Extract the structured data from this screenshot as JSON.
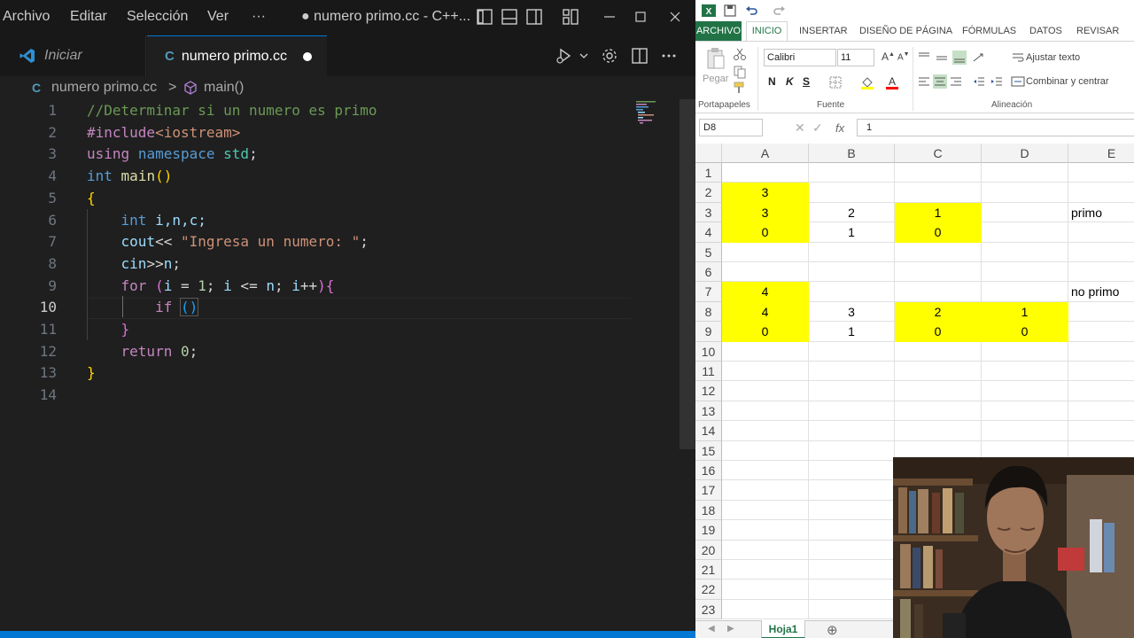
{
  "vscode": {
    "menu": [
      "Archivo",
      "Editar",
      "Selección",
      "Ver"
    ],
    "more": "···",
    "window_title": "● numero primo.cc - C++...",
    "tabs": {
      "start": "Iniciar",
      "file": "numero primo.cc",
      "file_badge": "C"
    },
    "breadcrumb": {
      "file": "numero primo.cc",
      "separator": ">",
      "symbol": "main()"
    },
    "line_numbers": [
      "1",
      "2",
      "3",
      "4",
      "5",
      "6",
      "7",
      "8",
      "9",
      "10",
      "11",
      "12",
      "13",
      "14"
    ],
    "active_line": "10",
    "code": {
      "l1": "//Determinar si un numero es primo",
      "l2_directive": "#include",
      "l2_header": "<iostream>",
      "l3_using": "using",
      "l3_namespace": "namespace",
      "l3_std": "std",
      "l3_semi": ";",
      "l4_int": "int",
      "l4_main": "main",
      "l4_parens": "()",
      "l5": "{",
      "l6_int": "int",
      "l6_vars": " i,n,c;",
      "l7_cout": "cout",
      "l7_op": "<< ",
      "l7_str": "\"Ingresa un numero: \"",
      "l7_semi": ";",
      "l8_cin": "cin",
      "l8_op": ">>",
      "l8_n": "n",
      "l8_semi": ";",
      "l9_for": "for",
      "l9_open": " (",
      "l9_i1": "i",
      "l9_eq": " = ",
      "l9_one": "1",
      "l9_s1": "; ",
      "l9_i2": "i",
      "l9_le": " <= ",
      "l9_n": "n",
      "l9_s2": "; ",
      "l9_i3": "i",
      "l9_inc": "++",
      "l9_close": ")",
      "l9_brace": "{",
      "l10_if": "if",
      "l10_parens": "()",
      "l11": "}",
      "l12_return": "return",
      "l12_zero": "0",
      "l12_semi": ";",
      "l13": "}"
    },
    "colors": {
      "accent": "#0078d4",
      "keyword": "#569cd6",
      "control": "#c586c0",
      "comment": "#6a9955",
      "string": "#ce9178"
    }
  },
  "excel": {
    "ribbon_tabs": [
      "ARCHIVO",
      "INICIO",
      "INSERTAR",
      "DISEÑO DE PÁGINA",
      "FÓRMULAS",
      "DATOS",
      "REVISAR"
    ],
    "clipboard": {
      "paste": "Pegar",
      "group": "Portapapeles"
    },
    "font": {
      "name": "Calibri",
      "size": "11",
      "bold": "N",
      "italic": "K",
      "underline": "S",
      "group": "Fuente"
    },
    "alignment": {
      "wrap": "Ajustar texto",
      "merge": "Combinar y centrar",
      "group": "Alineación"
    },
    "name_box": "D8",
    "fx": "fx",
    "formula_value": "1",
    "columns": [
      "A",
      "B",
      "C",
      "D",
      "E"
    ],
    "rows": [
      "1",
      "2",
      "3",
      "4",
      "5",
      "6",
      "7",
      "8",
      "9",
      "10",
      "11",
      "12",
      "13",
      "14",
      "15",
      "16",
      "17",
      "18",
      "19",
      "20",
      "21",
      "22",
      "23"
    ],
    "cells": {
      "A2": "3",
      "A3": "3",
      "B3": "2",
      "C3": "1",
      "E3": "primo",
      "A4": "0",
      "B4": "1",
      "C4": "0",
      "A7": "4",
      "E7": "no primo",
      "A8": "4",
      "B8": "3",
      "C8": "2",
      "D8": "1",
      "A9": "0",
      "B9": "1",
      "C9": "0",
      "D9": "0"
    },
    "highlight_color": "#ffff00",
    "sheet_tab": "Hoja1",
    "accent": "#217346"
  }
}
